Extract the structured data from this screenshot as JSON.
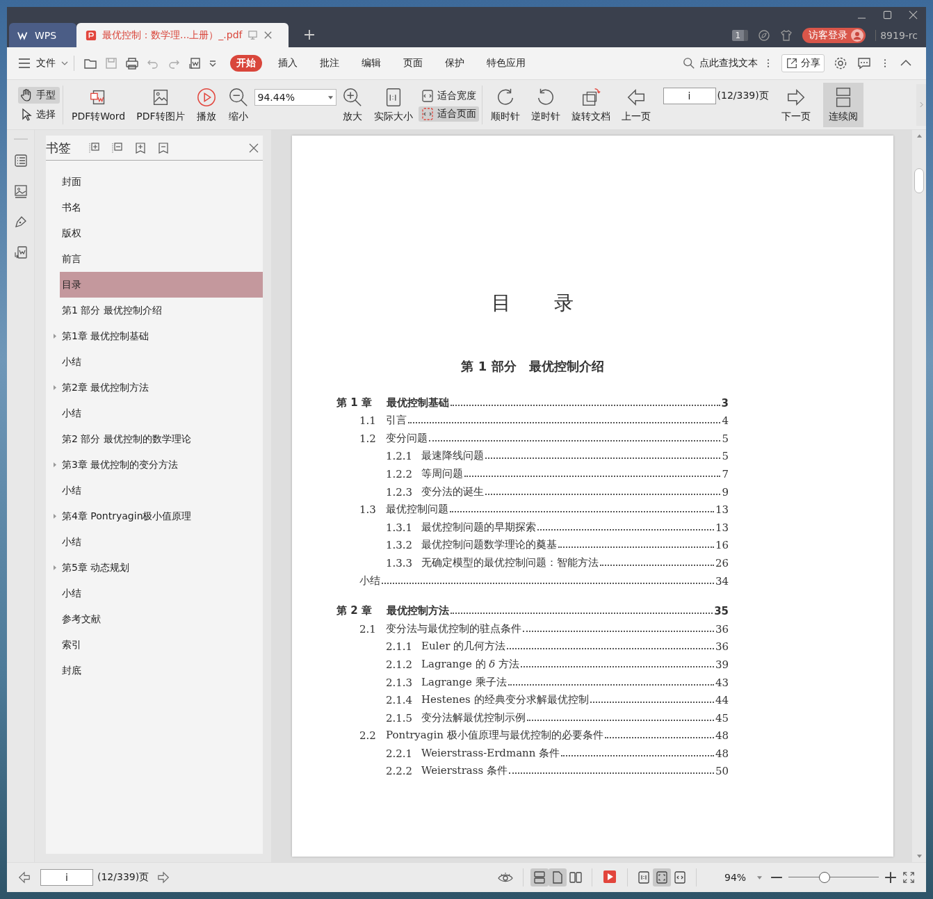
{
  "title_bar": {
    "tabs": [
      {
        "kind": "home",
        "label": "WPS",
        "selected": false
      },
      {
        "kind": "doc",
        "label": "最优控制：数学理...上册）_.pdf",
        "selected": true
      }
    ],
    "badge": "1",
    "login": "访客登录",
    "user": "8919-rc"
  },
  "menu": {
    "file": "文件",
    "tabs": [
      {
        "label": "开始",
        "selected": true
      },
      {
        "label": "插入",
        "selected": false
      },
      {
        "label": "批注",
        "selected": false
      },
      {
        "label": "编辑",
        "selected": false
      },
      {
        "label": "页面",
        "selected": false
      },
      {
        "label": "保护",
        "selected": false
      },
      {
        "label": "特色应用",
        "selected": false
      }
    ],
    "search": "点此查找文本",
    "share": "分享"
  },
  "toolbar": {
    "tools": [
      {
        "kind": "hand",
        "label": "手型",
        "selected": true
      },
      {
        "kind": "select",
        "label": "选择",
        "selected": false
      }
    ],
    "group_1": [
      {
        "kind": "to-word",
        "label": "PDF转Word"
      },
      {
        "kind": "to-image",
        "label": "PDF转图片"
      },
      {
        "kind": "play",
        "label": "播放"
      },
      {
        "kind": "zoom-out",
        "label": "缩小"
      }
    ],
    "zoom_value": "94.44%",
    "group_2": [
      {
        "kind": "zoom-in",
        "label": "放大"
      },
      {
        "kind": "actual",
        "label": "实际大小"
      }
    ],
    "fit": [
      {
        "kind": "width",
        "label": "适合宽度",
        "selected": false
      },
      {
        "kind": "page",
        "label": "适合页面",
        "selected": true
      }
    ],
    "group_3": [
      {
        "kind": "cw",
        "label": "顺时针"
      },
      {
        "kind": "ccw",
        "label": "逆时针"
      },
      {
        "kind": "rotate-doc",
        "label": "旋转文档"
      },
      {
        "kind": "prev",
        "label": "上一页"
      }
    ],
    "page_value": "i",
    "page_count": "(12/339)页",
    "group_4": [
      {
        "kind": "next",
        "label": "下一页"
      }
    ],
    "continuous": {
      "label": "连续阅",
      "selected": true
    }
  },
  "bookmarks": {
    "title": "书签",
    "items": [
      {
        "kind": "leaf",
        "label": "封面",
        "selected": false
      },
      {
        "kind": "leaf",
        "label": "书名",
        "selected": false
      },
      {
        "kind": "leaf",
        "label": "版权",
        "selected": false
      },
      {
        "kind": "leaf",
        "label": "前言",
        "selected": false
      },
      {
        "kind": "leaf",
        "label": "目录",
        "selected": true
      },
      {
        "kind": "leaf",
        "label": "第1 部分 最优控制介绍",
        "selected": false
      },
      {
        "kind": "branch",
        "label": "第1章 最优控制基础",
        "selected": false
      },
      {
        "kind": "leaf",
        "label": "小结",
        "selected": false
      },
      {
        "kind": "branch",
        "label": "第2章 最优控制方法",
        "selected": false
      },
      {
        "kind": "leaf",
        "label": "小结",
        "selected": false
      },
      {
        "kind": "leaf",
        "label": "第2 部分 最优控制的数学理论",
        "selected": false
      },
      {
        "kind": "branch",
        "label": "第3章 最优控制的变分方法",
        "selected": false
      },
      {
        "kind": "leaf",
        "label": "小结",
        "selected": false
      },
      {
        "kind": "branch",
        "label": "第4章 Pontryagin极小值原理",
        "selected": false
      },
      {
        "kind": "leaf",
        "label": "小结",
        "selected": false
      },
      {
        "kind": "branch",
        "label": "第5章 动态规划",
        "selected": false
      },
      {
        "kind": "leaf",
        "label": "小结",
        "selected": false
      },
      {
        "kind": "leaf",
        "label": "参考文献",
        "selected": false
      },
      {
        "kind": "leaf",
        "label": "索引",
        "selected": false
      },
      {
        "kind": "leaf",
        "label": "封底",
        "selected": false
      }
    ]
  },
  "page": {
    "title": "目录",
    "part_title": "第 1 部分　最优控制介绍",
    "entries": [
      {
        "kind": "chapter",
        "number": "第 1 章",
        "title": "最优控制基础",
        "page": "3"
      },
      {
        "kind": "section",
        "number": "1.1",
        "title": "引言",
        "page": "4"
      },
      {
        "kind": "section",
        "number": "1.2",
        "title": "变分问题",
        "page": "5"
      },
      {
        "kind": "subsection",
        "number": "1.2.1",
        "title": "最速降线问题",
        "page": "5"
      },
      {
        "kind": "subsection",
        "number": "1.2.2",
        "title": "等周问题",
        "page": "7"
      },
      {
        "kind": "subsection",
        "number": "1.2.3",
        "title": "变分法的诞生",
        "page": "9"
      },
      {
        "kind": "section",
        "number": "1.3",
        "title": "最优控制问题",
        "page": "13"
      },
      {
        "kind": "subsection",
        "number": "1.3.1",
        "title": "最优控制问题的早期探索",
        "page": "13"
      },
      {
        "kind": "subsection",
        "number": "1.3.2",
        "title": "最优控制问题数学理论的奠基",
        "page": "16"
      },
      {
        "kind": "subsection",
        "number": "1.3.3",
        "title": "无确定模型的最优控制问题：智能方法",
        "page": "26"
      },
      {
        "kind": "summary",
        "title": "小结",
        "page": "34"
      },
      {
        "kind": "chapter",
        "number": "第 2 章",
        "title": "最优控制方法",
        "page": "35"
      },
      {
        "kind": "section",
        "number": "2.1",
        "title": "变分法与最优控制的驻点条件",
        "page": "36"
      },
      {
        "kind": "subsection",
        "number": "2.1.1",
        "title": "Euler 的几何方法",
        "page": "36"
      },
      {
        "kind": "subsection",
        "number": "2.1.2",
        "title": "Lagrange 的 *δ* 方法",
        "page": "39"
      },
      {
        "kind": "subsection",
        "number": "2.1.3",
        "title": "Lagrange 乘子法",
        "page": "43"
      },
      {
        "kind": "subsection",
        "number": "2.1.4",
        "title": "Hestenes 的经典变分求解最优控制",
        "page": "44"
      },
      {
        "kind": "subsection",
        "number": "2.1.5",
        "title": "变分法解最优控制示例",
        "page": "45"
      },
      {
        "kind": "section",
        "number": "2.2",
        "title": "Pontryagin 极小值原理与最优控制的必要条件",
        "page": "48"
      },
      {
        "kind": "subsection",
        "number": "2.2.1",
        "title": "Weierstrass-Erdmann 条件",
        "page": "48"
      },
      {
        "kind": "subsection",
        "number": "2.2.2",
        "title": "Weierstrass 条件",
        "page": "50"
      }
    ]
  },
  "status_bar": {
    "page_value": "i",
    "page_count": "(12/339)页",
    "views": [
      {
        "kind": "continuous",
        "selected": true
      },
      {
        "kind": "single",
        "selected": true
      },
      {
        "kind": "double",
        "selected": false
      }
    ],
    "fits": [
      {
        "kind": "actual",
        "selected": false
      },
      {
        "kind": "page",
        "selected": true
      },
      {
        "kind": "width",
        "selected": false
      }
    ],
    "zoom": "94%",
    "zoom_slider": {
      "level": 0.4
    }
  }
}
